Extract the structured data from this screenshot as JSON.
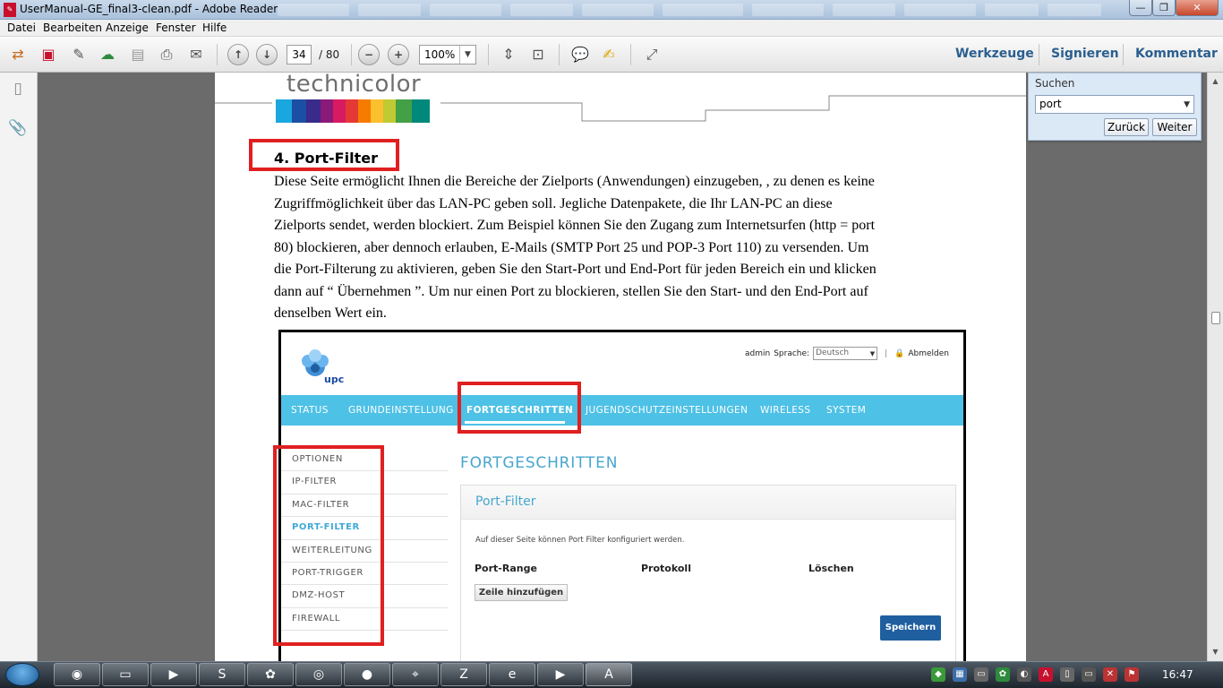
{
  "window": {
    "title": "UserManual-GE_final3-clean.pdf - Adobe Reader",
    "min": "—",
    "max": "❐",
    "close": "✕"
  },
  "menu": [
    "Datei",
    "Bearbeiten",
    "Anzeige",
    "Fenster",
    "Hilfe"
  ],
  "toolbar": {
    "page_current": "34",
    "page_total": "/ 80",
    "zoom": "100%",
    "links": [
      "Werkzeuge",
      "Signieren",
      "Kommentar"
    ]
  },
  "search": {
    "label": "Suchen",
    "value": "port",
    "back": "Zurück",
    "next": "Weiter"
  },
  "document": {
    "logo": "technicolor",
    "section_title": "4.  Port-Filter",
    "paragraph_lines": [
      "Diese Seite ermöglicht Ihnen die Bereiche der Zielports (Anwendungen) einzugeben, , zu denen es keine",
      "Zugriffmöglichkeit über das LAN-PC geben soll.  Jegliche Datenpakete, die Ihr LAN-PC an diese",
      "Zielports sendet, werden blockiert. Zum Beispiel können Sie den Zugang zum Internetsurfen (http = port",
      "80) blockieren, aber dennoch erlauben, E-Mails (SMTP Port 25 und POP-3 Port 110) zu versenden. Um",
      "die Port-Filterung zu aktivieren, geben Sie den Start-Port und End-Port für jeden Bereich ein und klicken",
      "dann auf “ Übernehmen ”. Um nur einen Port zu blockieren, stellen Sie  den Start- und den End-Port auf",
      "denselben Wert ein."
    ]
  },
  "router": {
    "brand": "upc",
    "user": "admin",
    "lang_label": "Sprache:",
    "lang_value": "Deutsch",
    "logout": "Abmelden",
    "nav": [
      "STATUS",
      "GRUNDEINSTELLUNG",
      "FORTGESCHRITTEN",
      "JUGENDSCHUTZEINSTELLUNGEN",
      "WIRELESS",
      "SYSTEM"
    ],
    "active_nav": "FORTGESCHRITTEN",
    "side": [
      "OPTIONEN",
      "IP-FILTER",
      "MAC-FILTER",
      "PORT-FILTER",
      "WEITERLEITUNG",
      "PORT-TRIGGER",
      "DMZ-HOST",
      "FIREWALL"
    ],
    "active_side": "PORT-FILTER",
    "heading": "FORTGESCHRITTEN",
    "panel_title": "Port-Filter",
    "panel_desc": "Auf dieser Seite können Port Filter konfiguriert werden.",
    "col_range": "Port-Range",
    "col_proto": "Protokoll",
    "col_delete": "Löschen",
    "add_row": "Zeile hinzufügen",
    "save": "Speichern"
  },
  "taskbar": {
    "clock": "16:47"
  },
  "colors": {
    "accent_blue": "#4ec1e6",
    "highlight_red": "#e02020",
    "link_blue": "#2a5f8f"
  }
}
